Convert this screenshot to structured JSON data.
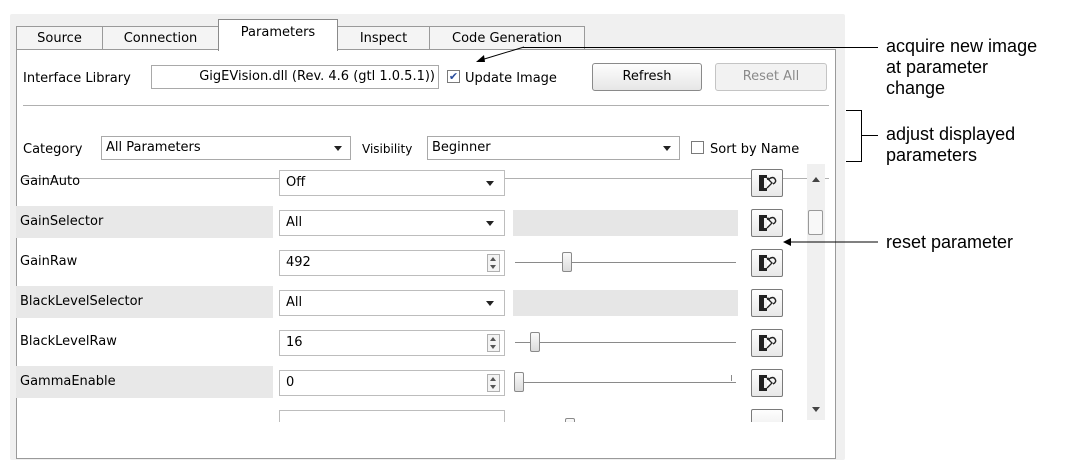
{
  "tabs": [
    {
      "label": "Source"
    },
    {
      "label": "Connection"
    },
    {
      "label": "Parameters",
      "active": true
    },
    {
      "label": "Inspect"
    },
    {
      "label": "Code Generation"
    }
  ],
  "interface": {
    "label": "Interface Library",
    "value": "GigEVision.dll (Rev. 4.6 (gtl 1.0.5.1))",
    "update_image_label": "Update Image",
    "update_image_checked": true,
    "refresh_label": "Refresh",
    "reset_all_label": "Reset All"
  },
  "filter": {
    "category_label": "Category",
    "category_value": "All Parameters",
    "visibility_label": "Visibility",
    "visibility_value": "Beginner",
    "sort_label": "Sort by Name",
    "sort_checked": false
  },
  "parameters": [
    {
      "name": "GainAuto",
      "value": "Off",
      "kind": "combo"
    },
    {
      "name": "GainSelector",
      "value": "All",
      "kind": "combo"
    },
    {
      "name": "GainRaw",
      "value": "492",
      "kind": "spin"
    },
    {
      "name": "BlackLevelSelector",
      "value": "All",
      "kind": "combo"
    },
    {
      "name": "BlackLevelRaw",
      "value": "16",
      "kind": "spin"
    },
    {
      "name": "GammaEnable",
      "value": "0",
      "kind": "spin"
    }
  ],
  "annotations": {
    "acquire": [
      "acquire new image",
      "at parameter",
      "change"
    ],
    "adjust": [
      "adjust displayed",
      "parameters"
    ],
    "reset": "reset parameter"
  }
}
